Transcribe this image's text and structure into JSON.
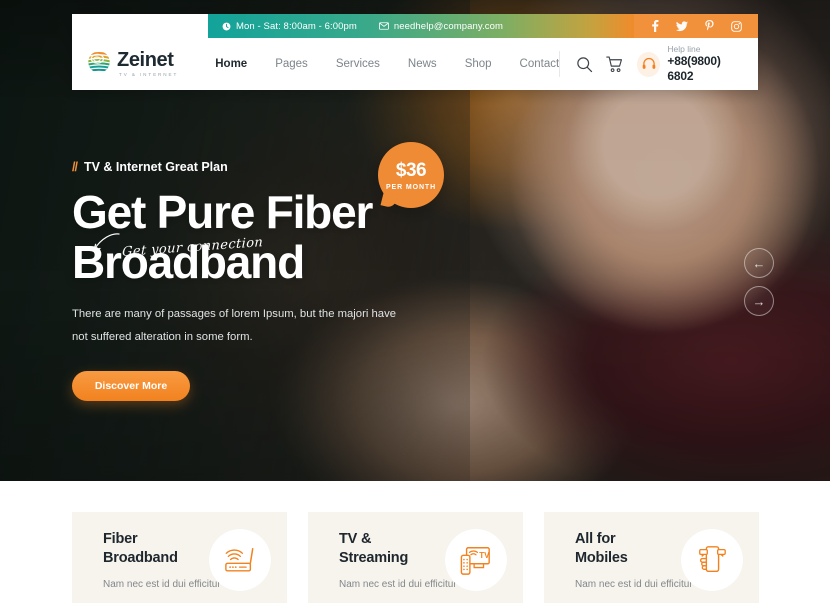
{
  "topbar": {
    "hours": "Mon - Sat: 8:00am - 6:00pm",
    "email": "needhelp@company.com",
    "clock_icon": "clock-icon",
    "mail_icon": "envelope-icon",
    "social": [
      {
        "name": "facebook-icon",
        "label": "f"
      },
      {
        "name": "twitter-icon",
        "label": "t"
      },
      {
        "name": "pinterest-icon",
        "label": "p"
      },
      {
        "name": "instagram-icon",
        "label": "i"
      }
    ]
  },
  "brand": {
    "name": "Zeinet",
    "tagline": "TV & INTERNET",
    "logo_icon": "globe-stripes-logo-icon"
  },
  "nav": {
    "items": [
      {
        "label": "Home",
        "active": true
      },
      {
        "label": "Pages",
        "active": false
      },
      {
        "label": "Services",
        "active": false
      },
      {
        "label": "News",
        "active": false
      },
      {
        "label": "Shop",
        "active": false
      },
      {
        "label": "Contact",
        "active": false
      }
    ]
  },
  "header_right": {
    "search_icon": "search-icon",
    "cart_icon": "shopping-cart-icon",
    "headset_icon": "headset-icon",
    "help_label": "Help line",
    "help_number": "+88(9800) 6802"
  },
  "hero": {
    "eyebrow_slash": "//",
    "eyebrow": "TV & Internet Great Plan",
    "title_line1": "Get Pure Fiber",
    "title_line2": "Broadband",
    "subtitle": "There are many of passages of lorem Ipsum, but the majori have not suffered alteration in some form.",
    "cta_label": "Discover More",
    "script_text": "Get your connection",
    "badge": {
      "amount": "$36",
      "period": "PER MONTH"
    },
    "carousel": {
      "prev": "←",
      "next": "→"
    }
  },
  "features": {
    "cards": [
      {
        "title_line1": "Fiber",
        "title_line2": "Broadband",
        "desc": "Nam nec est id dui efficitur",
        "icon": "wifi-router-icon"
      },
      {
        "title_line1": "TV &",
        "title_line2": "Streaming",
        "desc": "Nam nec est id dui efficitur",
        "icon": "tv-remote-icon"
      },
      {
        "title_line1": "All for",
        "title_line2": "Mobiles",
        "desc": "Nam nec est id dui efficitur",
        "icon": "hand-mobile-icon"
      }
    ]
  },
  "colors": {
    "accent_orange": "#f2821f",
    "topbar_teal": "#12a39a",
    "social_orange": "#f2913c",
    "card_bg": "#f7f3ed",
    "dark_text": "#1e272d"
  }
}
